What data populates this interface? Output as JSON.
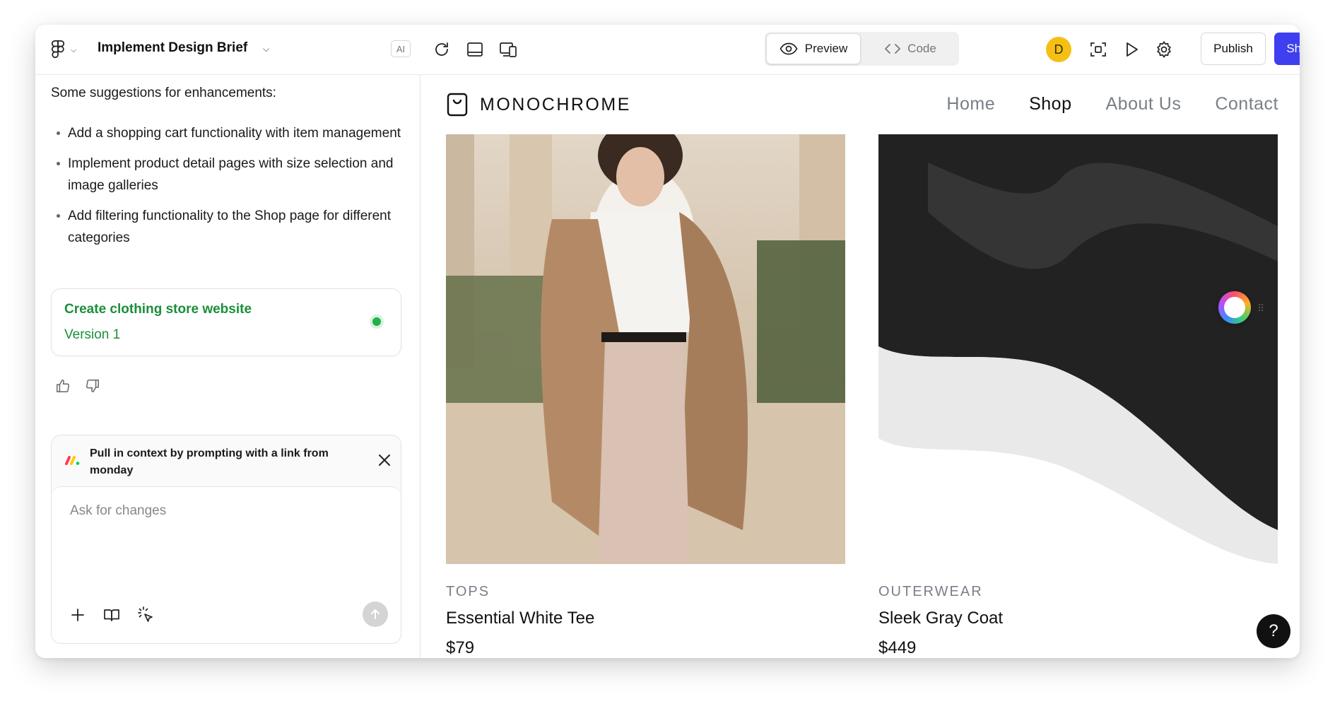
{
  "project": {
    "title": "Implement Design Brief",
    "ai_badge": "AI"
  },
  "chat": {
    "intro": "Some suggestions for enhancements:",
    "suggestions": [
      "Add a shopping cart functionality with item management",
      "Implement product detail pages with size selection and image galleries",
      "Add filtering functionality to the Shop page for different categories"
    ],
    "version_card": {
      "title": "Create clothing store website",
      "subtitle": "Version 1"
    }
  },
  "prompt": {
    "banner": "Pull in context by prompting with a link from monday",
    "placeholder": "Ask for changes"
  },
  "toolbar": {
    "preview_label": "Preview",
    "code_label": "Code",
    "avatar_initial": "D",
    "publish_label": "Publish",
    "share_label": "Share"
  },
  "site": {
    "brand": "MONOCHROME",
    "nav": [
      "Home",
      "Shop",
      "About Us",
      "Contact"
    ],
    "products": [
      {
        "category": "TOPS",
        "name": "Essential White Tee",
        "price": "$79"
      },
      {
        "category": "OUTERWEAR",
        "name": "Sleek Gray Coat",
        "price": "$449"
      }
    ]
  },
  "help_label": "?",
  "colors": {
    "accent": "#3f3ff0",
    "version_green": "#1a8f3a",
    "avatar": "#f5c014"
  }
}
